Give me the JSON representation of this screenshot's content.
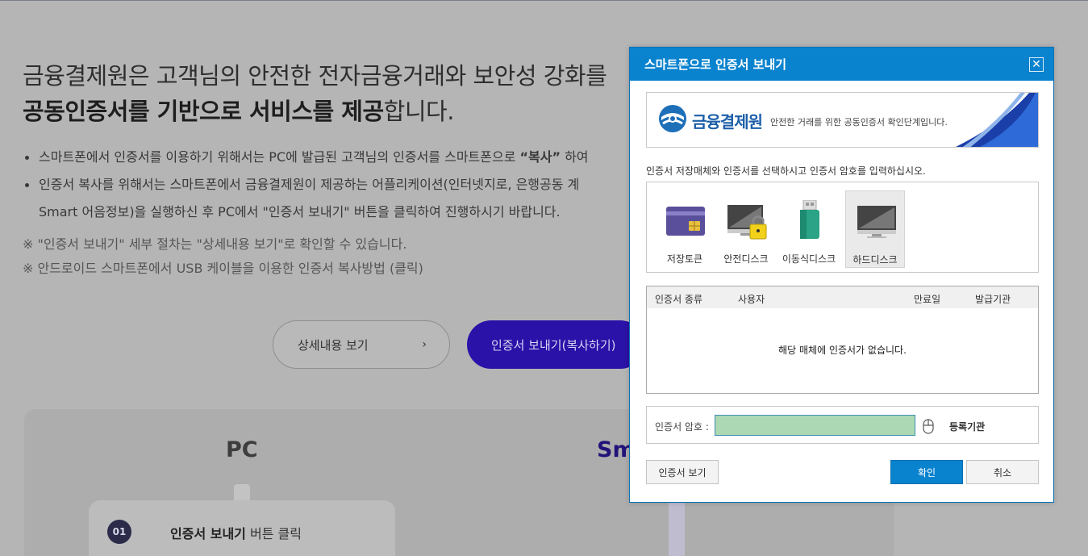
{
  "background": {
    "headline_line1": "금융결제원은 고객님의 안전한 전자금융거래와 보안성 강화를 ",
    "headline_line2_bold": "공동인증서를 기반으로 서비스를 제공",
    "headline_line2_rest": "합니다.",
    "bullet1_pre": "스마트폰에서 인증서를 이용하기 위해서는 PC에 발급된 고객님의 인증서를 스마트폰으로 ",
    "bullet1_bold": "“복사”",
    "bullet1_post": " 하여",
    "bullet2": "인증서 복사를 위해서는 스마트폰에서 금융결제원이 제공하는 어플리케이션(인터넷지로, 은행공동 계",
    "bullet2_cont": "Smart 어음정보)을 실행하신 후 PC에서 \"인증서 보내기\" 버튼을 클릭하여 진행하시기 바랍니다.",
    "note1": "※ \"인증서 보내기\" 세부 절차는 \"상세내용 보기\"로 확인할 수 있습니다.",
    "note2": "※ 안드로이드 스마트폰에서 USB 케이블을 이용한 인증서 복사방법 (클릭)",
    "btn_detail": "상세내용 보기",
    "btn_detail_chevron": "›",
    "btn_send": "인증서 보내기(복사하기)",
    "pc_title": "PC",
    "smartphone_title": "Sm",
    "step_num": "01",
    "step_bold": "인증서 보내기",
    "step_rest": " 버튼 클릭"
  },
  "dialog": {
    "title": "스마트폰으로 인증서 보내기",
    "close": "✕",
    "banner_name": "금융결제원",
    "banner_desc": "안전한 거래를 위한 공동인증서 확인단계입니다.",
    "instruction": "인증서 저장매체와 인증서를 선택하시고 인증서 암호를 입력하십시오.",
    "media": [
      {
        "label": "저장토큰",
        "icon": "smartcard-icon",
        "selected": false
      },
      {
        "label": "안전디스크",
        "icon": "secure-disk-icon",
        "selected": false
      },
      {
        "label": "이동식디스크",
        "icon": "usb-drive-icon",
        "selected": false
      },
      {
        "label": "하드디스크",
        "icon": "hard-disk-icon",
        "selected": true
      }
    ],
    "table_headers": [
      "인증서 종류",
      "사용자",
      "만료일",
      "발급기관"
    ],
    "table_empty": "해당 매체에 인증서가 없습니다.",
    "pw_label": "인증서 암호 :",
    "pw_value": "",
    "pw_register": "등록기관",
    "btn_view": "인증서 보기",
    "btn_ok": "확인",
    "btn_cancel": "취소",
    "colors": {
      "title_bar": "#0a83cf",
      "pw_field": "#acd8b3",
      "brand": "#1d5fa9"
    }
  }
}
